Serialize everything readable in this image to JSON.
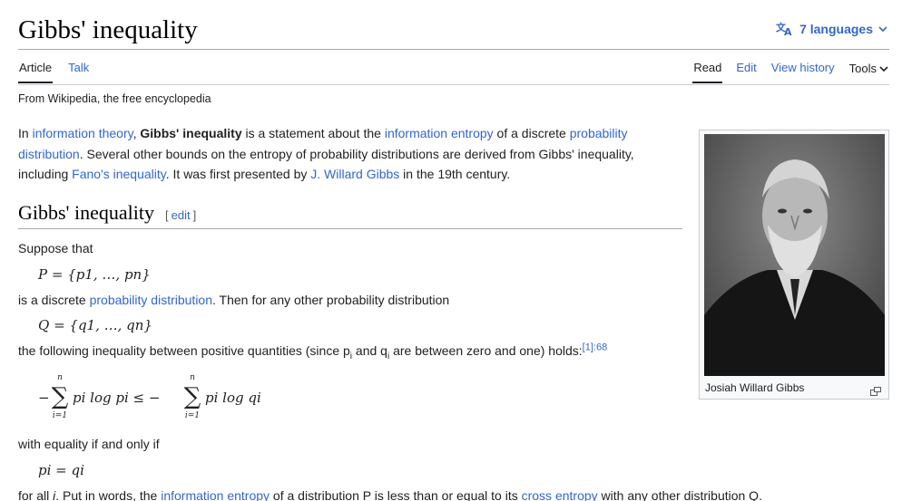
{
  "header": {
    "title": "Gibbs' inequality",
    "languages": "7 languages"
  },
  "tabs": {
    "left": [
      "Article",
      "Talk"
    ],
    "right": [
      "Read",
      "Edit",
      "View history",
      "Tools"
    ]
  },
  "tagline": "From Wikipedia, the free encyclopedia",
  "intro": {
    "t1": "In ",
    "l1": "information theory",
    "t2": ", ",
    "b1": "Gibbs' inequality",
    "t3": " is a statement about the ",
    "l2": "information entropy",
    "t4": " of a discrete ",
    "l3": "probability distribution",
    "t5": ". Several other bounds on the entropy of probability distributions are derived from Gibbs' inequality, including ",
    "l4": "Fano's inequality",
    "t6": ". It was first presented by ",
    "l5": "J. Willard Gibbs",
    "t7": " in the 19th century."
  },
  "section": {
    "heading": "Gibbs' inequality",
    "edit_open": "[",
    "edit_label": "edit",
    "edit_close": "]",
    "suppose": "Suppose that",
    "math_p": "P = {p1, …, pn}",
    "is_discrete_1": "is a discrete ",
    "is_discrete_link": "probability distribution",
    "is_discrete_2": ". Then for any other probability distribution",
    "math_q": "Q = {q1, …, qn}",
    "following_1": "the following inequality between positive quantities (since p",
    "following_sub_i": "i",
    "following_2": " and q",
    "following_3": " are between zero and one) holds:",
    "ref": "[1]:68",
    "ineq_lhs": "pi log pi ≤ −",
    "ineq_rhs": "pi log qi",
    "sum_upper": "n",
    "sum_lower": "i=1",
    "equality": "with equality if and only if",
    "math_eq": "pi = qi",
    "final_1": "for all ",
    "final_i": "i",
    "final_2": ". Put in words, the ",
    "final_link1": "information entropy",
    "final_3": " of a distribution P is less than or equal to its ",
    "final_link2": "cross entropy",
    "final_4": " with any other distribution Q."
  },
  "infobox": {
    "caption": "Josiah Willard Gibbs"
  },
  "colors": {
    "link": "#3366cc",
    "text": "#202122",
    "border": "#a2a9b1"
  }
}
